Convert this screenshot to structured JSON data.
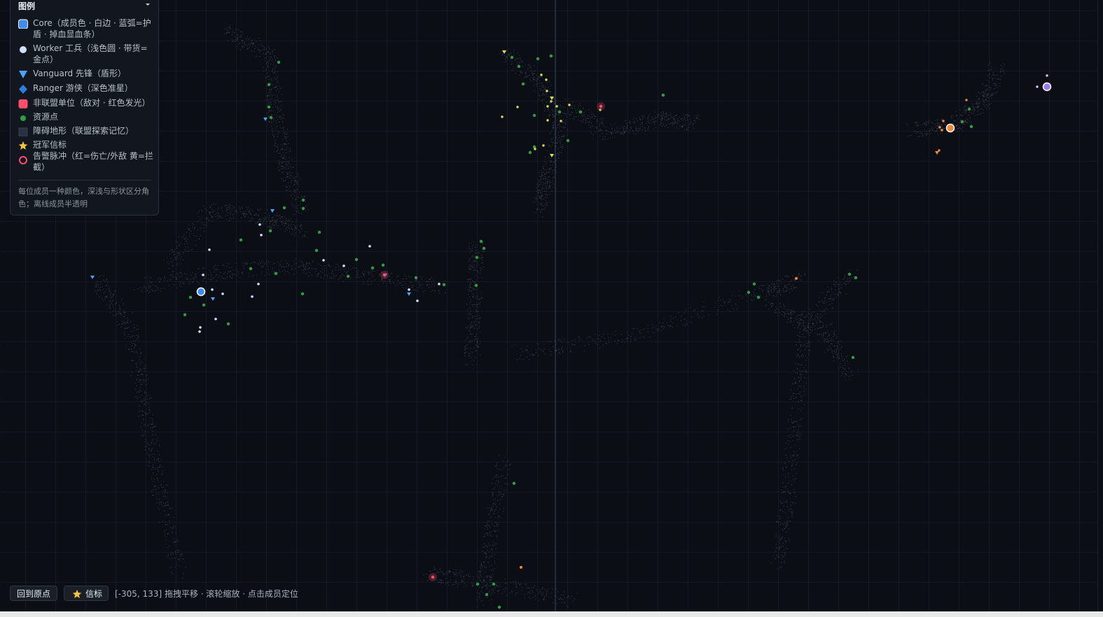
{
  "legend": {
    "title": "图例",
    "items": [
      {
        "key": "core",
        "label": "Core（成员色 · 白边 · 蓝弧=护盾 · 掉血显血条）"
      },
      {
        "key": "worker",
        "label": "Worker 工兵（浅色圆 · 带货=金点）"
      },
      {
        "key": "vanguard",
        "label": "Vanguard 先锋（盾形）"
      },
      {
        "key": "ranger",
        "label": "Ranger 游侠（深色准星）"
      },
      {
        "key": "hostile",
        "label": "非联盟单位（敌对 · 红色发光）"
      },
      {
        "key": "resource",
        "label": "资源点"
      },
      {
        "key": "obstacle",
        "label": "障碍地形（联盟探索记忆）"
      },
      {
        "key": "champion",
        "label": "冠军信标"
      },
      {
        "key": "alarm",
        "label": "告警脉冲（红=伤亡/外敌 黄=拦截）"
      }
    ],
    "note": "每位成员一种颜色，深浅与形状区分角色；离线成员半透明"
  },
  "toolbar": {
    "reset_label": "回到原点",
    "beacon_label": "信标"
  },
  "status": {
    "coords": "[-305, 133]",
    "hint": "拖拽平移 · 滚轮缩放 · 点击成员定位"
  },
  "colors": {
    "background": "#0b0e14",
    "core_blue": "#3f8cf0",
    "worker_light": "#cfe3ff",
    "vanguard_blue": "#4aa3ff",
    "ranger_blue": "#2e7de0",
    "hostile_red": "#ff4d6d",
    "resource_green": "#2ea043",
    "obstacle_gray": "#3a4150",
    "champion_gold": "#f5c542",
    "alarm_red": "#ff4d6d",
    "member_yellow": "#d4e157",
    "member_orange": "#f0883e",
    "member_purple": "#9b7cf0"
  },
  "icons": {
    "toggle": "chevron-down-icon",
    "beacon": "star-icon"
  }
}
